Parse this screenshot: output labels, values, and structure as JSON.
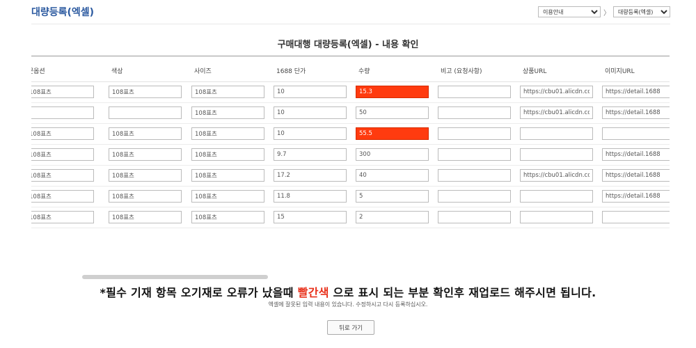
{
  "header": {
    "title": "대량등록(엑셀)",
    "breadcrumb": {
      "first_select": {
        "selected": "이용안내"
      },
      "separator": "〉",
      "second_select": {
        "selected": "대량등록(엑셀)"
      }
    }
  },
  "section_title": "구매대행 대량등록(엑셀) - 내용 확인",
  "table": {
    "columns": [
      "·문옵션",
      "색상",
      "사이즈",
      "1688 단가",
      "수량",
      "비고 (요청사항)",
      "상품URL",
      "이미지URL"
    ],
    "rows": [
      {
        "cells": [
          "108표츠",
          "108표츠",
          "108표츠",
          "10",
          "15.3",
          "",
          "https://cbu01.alicdn.co",
          "https://detail.1688"
        ],
        "error_col": 4
      },
      {
        "cells": [
          "",
          "",
          "108표츠",
          "10",
          "50",
          "",
          "https://cbu01.alicdn.co",
          "https://detail.1688"
        ],
        "error_col": -1
      },
      {
        "cells": [
          "108표츠",
          "108표츠",
          "108표츠",
          "10",
          "55.5",
          "",
          "",
          ""
        ],
        "error_col": 4
      },
      {
        "cells": [
          "108표츠",
          "108표츠",
          "108표츠",
          "9.7",
          "300",
          "",
          "",
          "https://detail.1688"
        ],
        "error_col": -1
      },
      {
        "cells": [
          "108표츠",
          "108표츠",
          "108표츠",
          "17.2",
          "40",
          "",
          "https://cbu01.alicdn.co",
          "https://detail.1688"
        ],
        "error_col": -1
      },
      {
        "cells": [
          "108표츠",
          "108표츠",
          "108표츠",
          "11.8",
          "5",
          "",
          "",
          "https://detail.1688"
        ],
        "error_col": -1
      },
      {
        "cells": [
          "108표츠",
          "108표츠",
          "108표츠",
          "15",
          "2",
          "",
          "",
          ""
        ],
        "error_col": -1
      }
    ]
  },
  "notice": {
    "prefix": "*필수 기재 항목 오기재로 오류가 났을때 ",
    "highlight": "빨간색",
    "suffix": " 으로 표시 되는 부분 확인후 재업로드 해주시면 됩니다."
  },
  "sub_notice": "엑셀에 잘못된 입력 내용이 있습니다. 수정하시고 다시 등록하십시오.",
  "back_button_label": "뒤로 가기",
  "colors": {
    "title": "#2c5aa0",
    "error": "#ff3b0f",
    "highlight_text": "#e8301a"
  }
}
